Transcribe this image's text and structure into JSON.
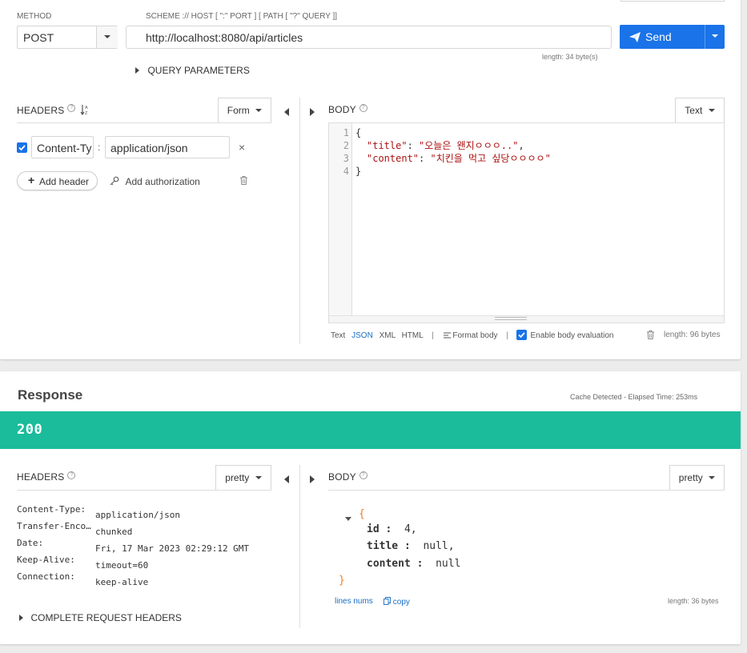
{
  "request": {
    "method_label": "METHOD",
    "method_value": "POST",
    "url_label": "SCHEME :// HOST [ \":\" PORT ] [ PATH [ \"?\" QUERY ]]",
    "url_value": "http://localhost:8080/api/articles",
    "url_length": "length: 34 byte(s)",
    "send_label": "Send",
    "query_params_label": "QUERY PARAMETERS",
    "headers_label": "HEADERS",
    "headers_mode": "Form",
    "header_rows": [
      {
        "name": "Content-Ty",
        "value": "application/json",
        "checked": true
      }
    ],
    "add_header_label": "Add header",
    "add_auth_label": "Add authorization",
    "body_label": "BODY",
    "body_mode": "Text",
    "body_line_numbers": [
      "1",
      "2",
      "3",
      "4"
    ],
    "body_lines": {
      "l1": "{",
      "l2_key": "\"title\"",
      "l2_sep": ": ",
      "l2_val": "\"오늘은 왠지ㅇㅇㅇ..\"",
      "l2_end": ",",
      "l3_key": "\"content\"",
      "l3_sep": ": ",
      "l3_val": "\"치킨을 먹고 싶당ㅇㅇㅇㅇ\"",
      "l4": "}"
    },
    "body_formats": [
      "Text",
      "JSON",
      "XML",
      "HTML"
    ],
    "format_body_label": "Format body",
    "enable_eval_label": "Enable body evaluation",
    "body_length": "length: 96 bytes"
  },
  "response": {
    "title": "Response",
    "cache_info": "Cache Detected - Elapsed Time: 253ms",
    "status_code": "200",
    "status_color": "#1abc9c",
    "headers_label": "HEADERS",
    "headers_mode": "pretty",
    "headers": [
      {
        "name": "Content-Type:",
        "value": "application/json"
      },
      {
        "name": "Transfer-Enco…",
        "value": "chunked"
      },
      {
        "name": "Date:",
        "value": "Fri, 17 Mar 2023 02:29:12 GMT"
      },
      {
        "name": "Keep-Alive:",
        "value": "timeout=60"
      },
      {
        "name": "Connection:",
        "value": "keep-alive"
      }
    ],
    "complete_headers_label": "COMPLETE REQUEST HEADERS",
    "body_label": "BODY",
    "body_mode": "pretty",
    "json": {
      "open": "{",
      "close": "}",
      "fields": [
        {
          "key": "id",
          "sep": " :  ",
          "value": "4",
          "end": ","
        },
        {
          "key": "title",
          "sep": " :  ",
          "value": "null",
          "end": ","
        },
        {
          "key": "content",
          "sep": " :  ",
          "value": "null",
          "end": ""
        }
      ]
    },
    "lines_nums_label": "lines nums",
    "copy_label": "copy",
    "body_length": "length: 36 bytes"
  },
  "colors": {
    "accent": "#1a73e8",
    "link": "#1a6dc2"
  }
}
